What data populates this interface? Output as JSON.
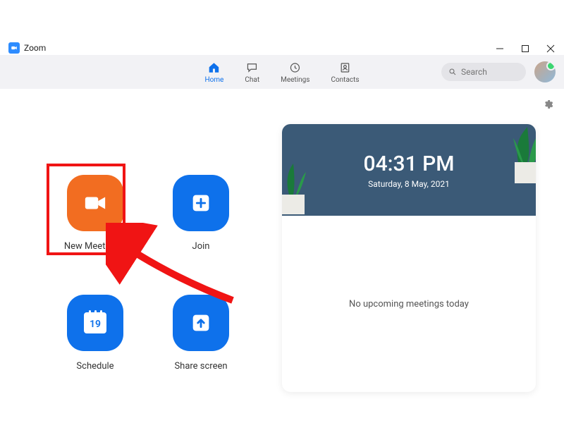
{
  "window": {
    "title": "Zoom"
  },
  "nav": {
    "tabs": [
      {
        "label": "Home",
        "icon": "home",
        "active": true
      },
      {
        "label": "Chat",
        "icon": "chat",
        "active": false
      },
      {
        "label": "Meetings",
        "icon": "clock",
        "active": false
      },
      {
        "label": "Contacts",
        "icon": "contacts",
        "active": false
      }
    ],
    "search_placeholder": "Search"
  },
  "tiles": {
    "new_meeting": {
      "label": "New Meeting",
      "has_dropdown": true
    },
    "join": {
      "label": "Join"
    },
    "schedule": {
      "label": "Schedule",
      "day": "19"
    },
    "share_screen": {
      "label": "Share screen"
    }
  },
  "panel": {
    "time": "04:31 PM",
    "date": "Saturday, 8 May, 2021",
    "empty_text": "No upcoming meetings today"
  },
  "annotation": {
    "highlight_target": "new-meeting-tile"
  }
}
